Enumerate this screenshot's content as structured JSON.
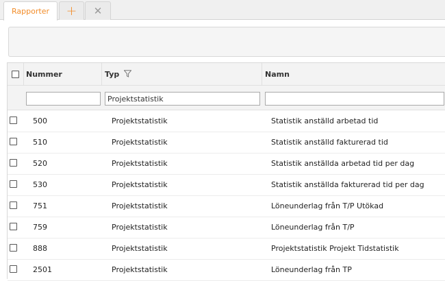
{
  "tabs": {
    "active_label": "Rapporter",
    "add_icon": "plus-icon",
    "close_icon": "close-icon",
    "accent_color": "#f28c28"
  },
  "grid": {
    "columns": {
      "number": "Nummer",
      "type": "Typ",
      "name": "Namn"
    },
    "filters": {
      "number": "",
      "type": "Projektstatistik",
      "name": ""
    },
    "rows": [
      {
        "number": "500",
        "type": "Projektstatistik",
        "name": "Statistik anställd arbetad tid"
      },
      {
        "number": "510",
        "type": "Projektstatistik",
        "name": "Statistik anställd fakturerad tid"
      },
      {
        "number": "520",
        "type": "Projektstatistik",
        "name": "Statistik anställda arbetad tid per dag"
      },
      {
        "number": "530",
        "type": "Projektstatistik",
        "name": "Statistik anställda fakturerad tid per dag"
      },
      {
        "number": "751",
        "type": "Projektstatistik",
        "name": "Löneunderlag från T/P Utökad"
      },
      {
        "number": "759",
        "type": "Projektstatistik",
        "name": "Löneunderlag från T/P"
      },
      {
        "number": "888",
        "type": "Projektstatistik",
        "name": "Projektstatistik Projekt Tidstatistik"
      },
      {
        "number": "2501",
        "type": "Projektstatistik",
        "name": "Löneunderlag från TP"
      }
    ]
  }
}
